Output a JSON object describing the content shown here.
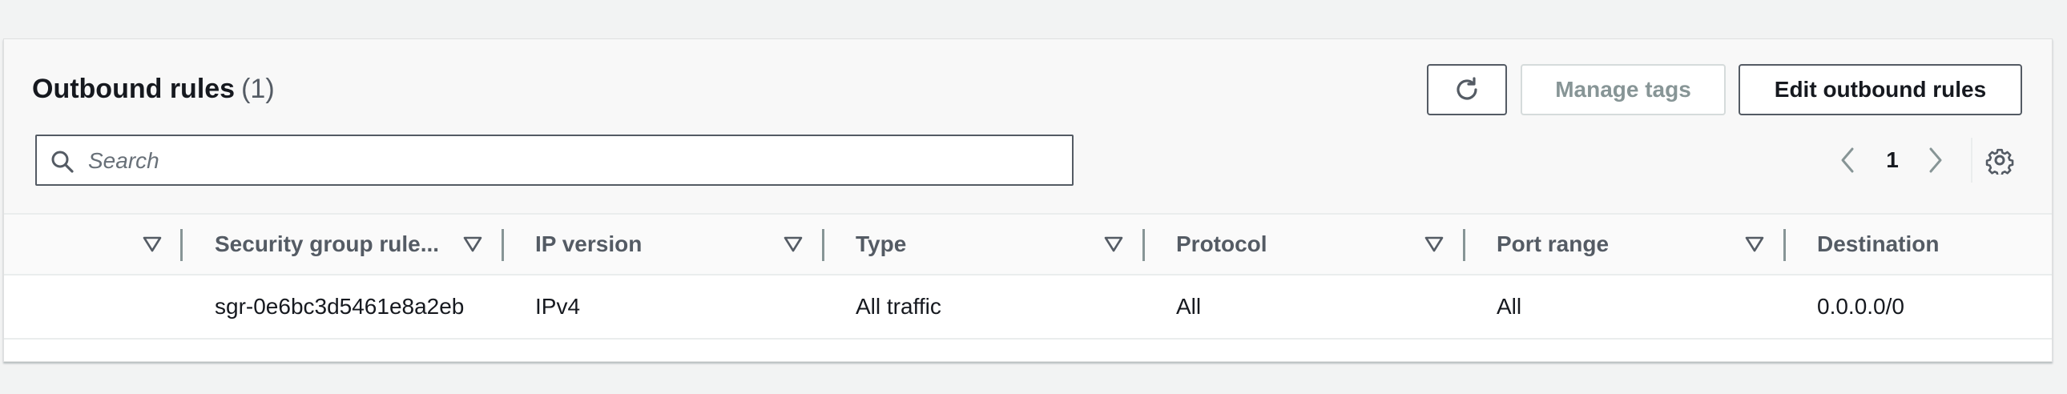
{
  "header": {
    "title": "Outbound rules",
    "count": "(1)"
  },
  "toolbar": {
    "refresh_icon": "refresh-icon",
    "manage_tags_label": "Manage tags",
    "edit_label": "Edit outbound rules"
  },
  "search": {
    "placeholder": "Search",
    "value": "",
    "icon": "search-icon"
  },
  "pagination": {
    "current_page": "1",
    "prev_icon": "chevron-left-icon",
    "next_icon": "chevron-right-icon",
    "settings_icon": "gear-icon"
  },
  "table": {
    "columns": [
      {
        "label": ""
      },
      {
        "label": "Security group rule..."
      },
      {
        "label": "IP version"
      },
      {
        "label": "Type"
      },
      {
        "label": "Protocol"
      },
      {
        "label": "Port range"
      },
      {
        "label": "Destination"
      }
    ],
    "rows": [
      {
        "rule_id": "sgr-0e6bc3d5461e8a2eb",
        "ip_version": "IPv4",
        "type": "All traffic",
        "protocol": "All",
        "port_range": "All",
        "destination": "0.0.0.0/0"
      }
    ]
  },
  "colors": {
    "text_primary": "#16191f",
    "text_secondary": "#545b64",
    "disabled": "#879596",
    "border": "#eaeded"
  }
}
